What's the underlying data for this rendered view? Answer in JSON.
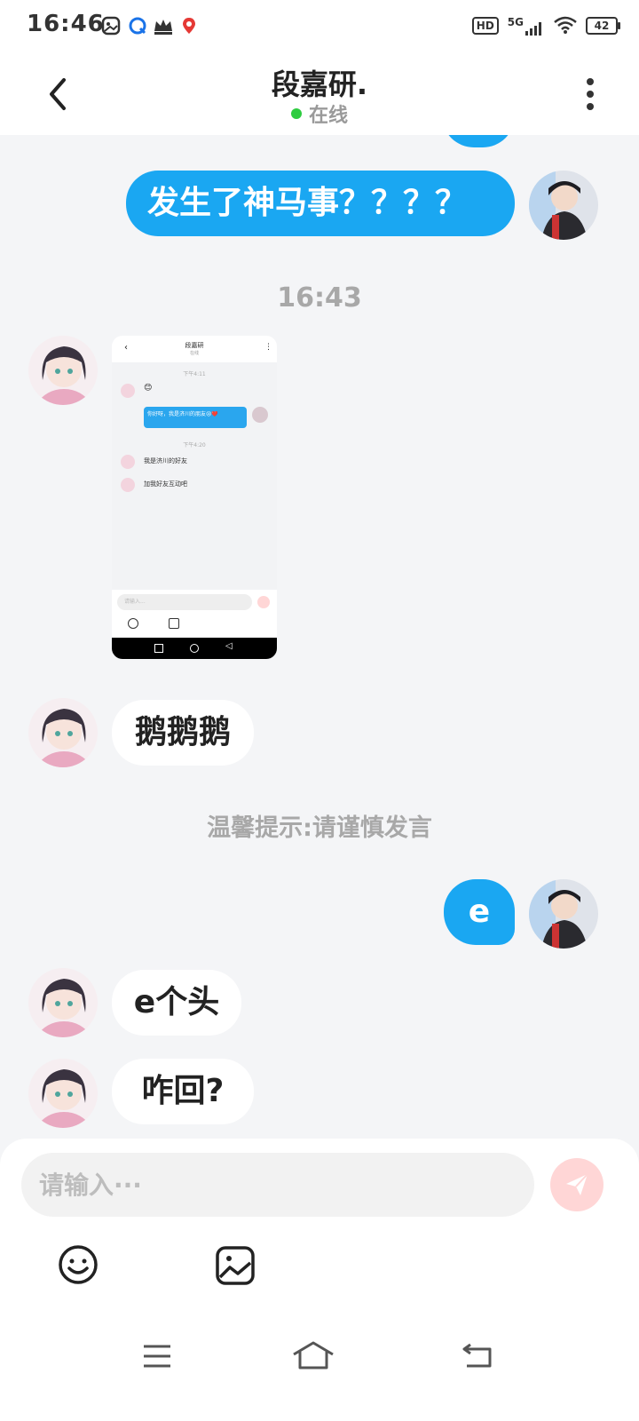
{
  "status_bar": {
    "time": "16:46",
    "hd": "HD",
    "network": "5G",
    "battery": "42"
  },
  "header": {
    "title": "段嘉研.",
    "status": "在线"
  },
  "messages": {
    "m1": "发生了神马事？？？？",
    "time1": "16:43",
    "m2": "鹅鹅鹅",
    "notice": "温馨提示:请谨慎发言",
    "m3": "e",
    "m4": "e个头",
    "m5": "咋回?"
  },
  "screenshot": {
    "title": "段嘉研",
    "status": "在线",
    "time_a": "下午4:11",
    "msg_a": "😊",
    "msg_b": "你好呀，我是济川的朋友😢❤️",
    "time_b": "下午4:20",
    "msg_c": "我是济川的好友",
    "msg_d": "加我好友互动吧",
    "placeholder": "请输入..."
  },
  "composer": {
    "placeholder": "请输入···"
  },
  "colors": {
    "accent": "#1aa7f2",
    "online": "#2ecc40",
    "send": "#ffd6d6"
  }
}
